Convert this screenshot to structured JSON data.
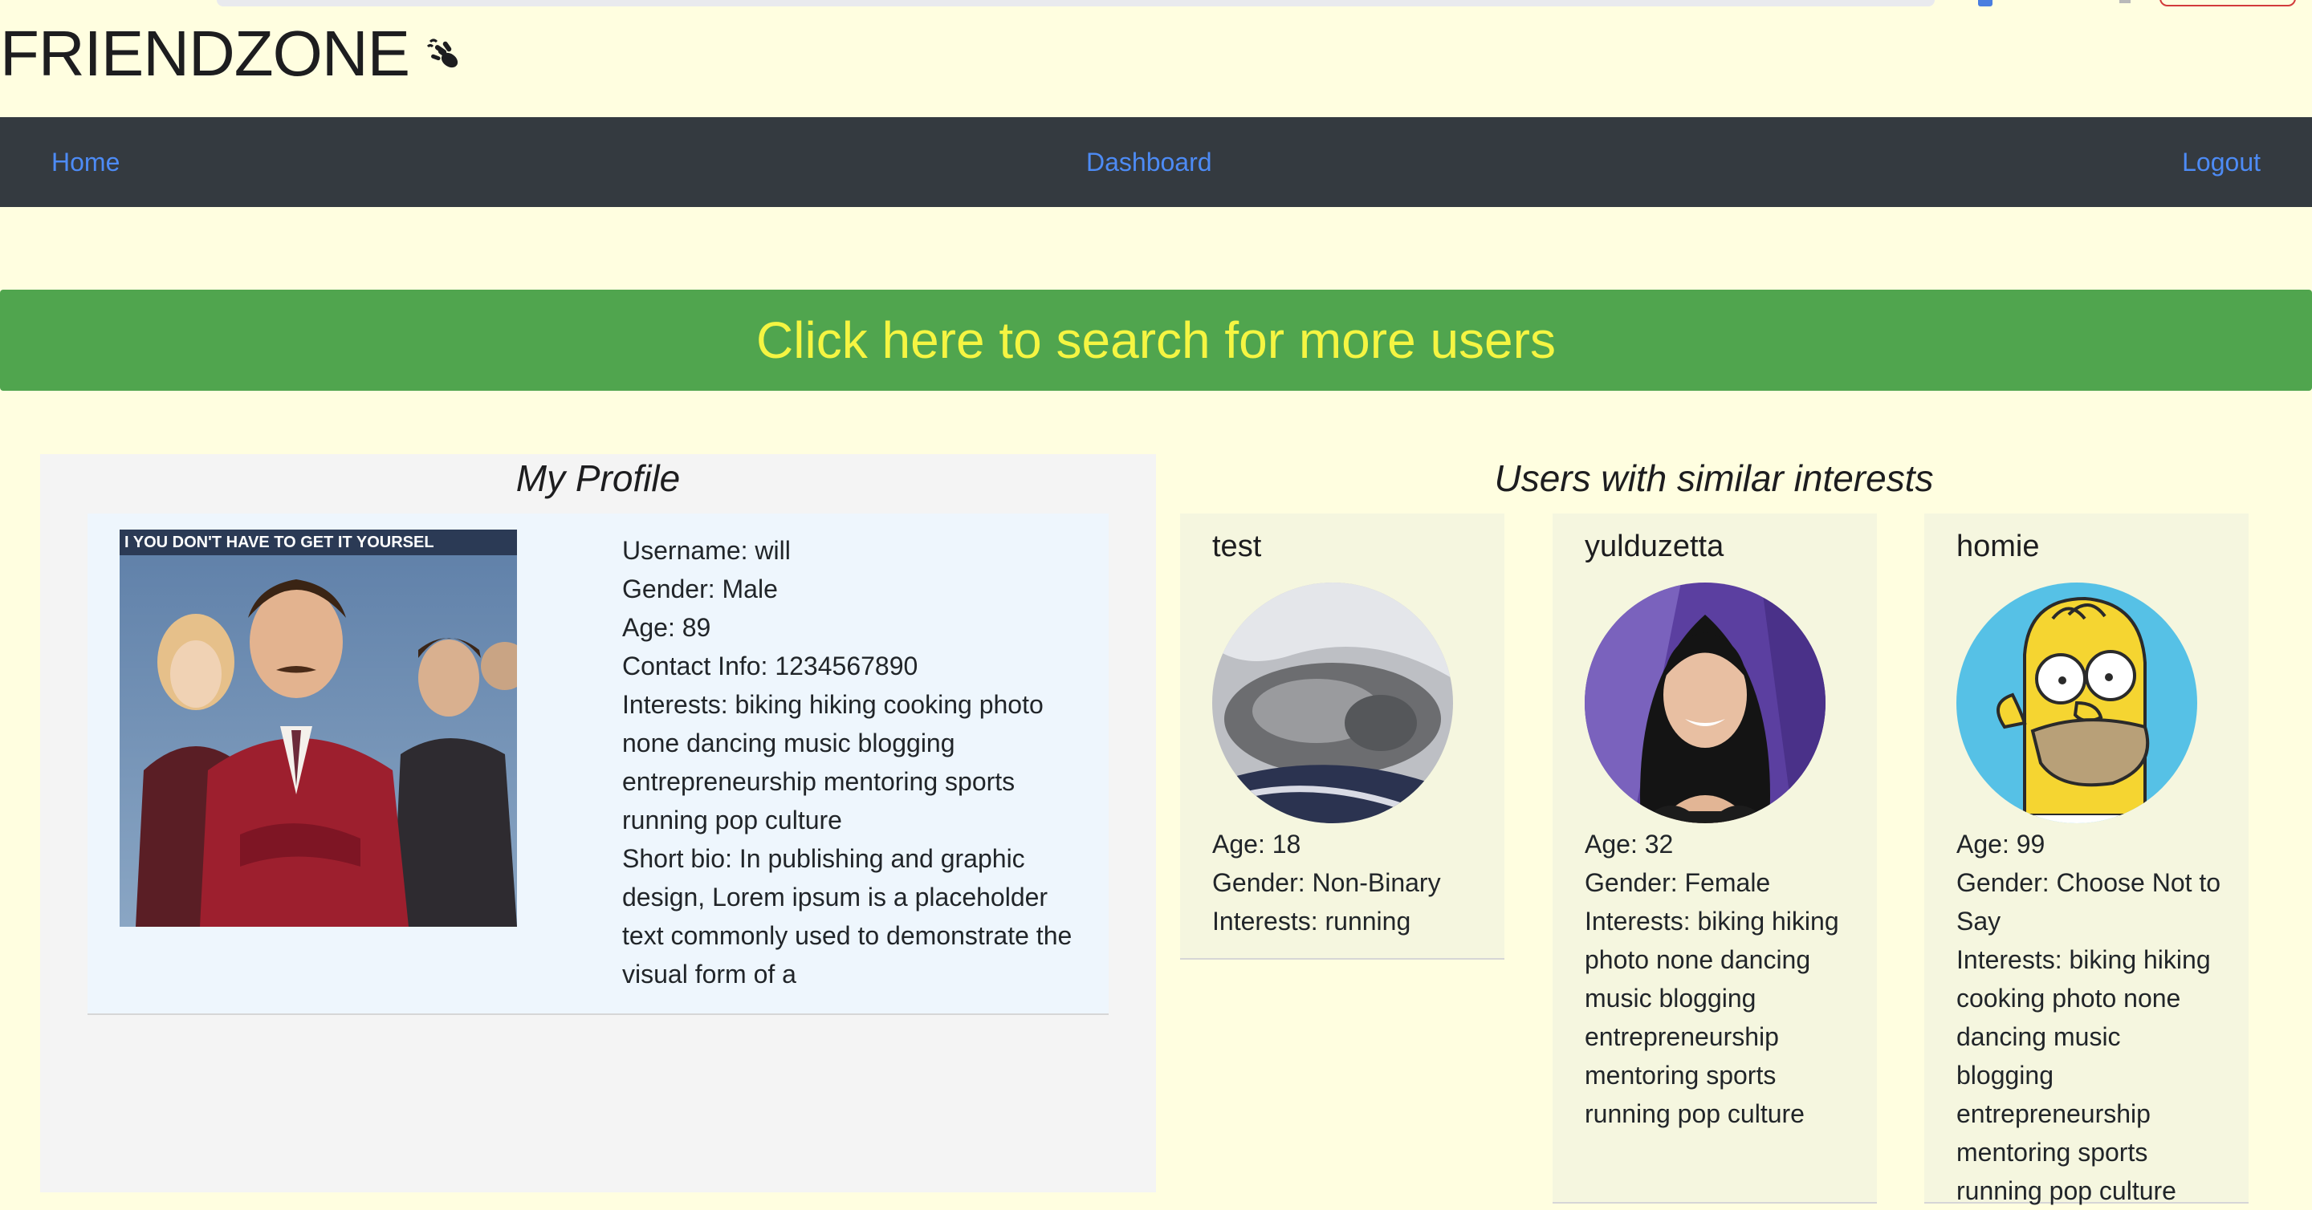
{
  "brand": {
    "title": "FRIENDZONE",
    "icon": "hand-wave-icon"
  },
  "nav": {
    "home": "Home",
    "dashboard": "Dashboard",
    "logout": "Logout"
  },
  "search_banner": {
    "label": "Click here to search for more users"
  },
  "my_profile": {
    "title": "My Profile",
    "photo_caption": "I YOU DON'T HAVE TO GET IT YOURSEL",
    "username": "Username: will",
    "gender": "Gender: Male",
    "age": "Age: 89",
    "contact": "Contact Info: 1234567890",
    "interests": "Interests: biking hiking cooking photo none dancing music blogging entrepreneurship mentoring sports running pop culture",
    "bio": "Short bio: In publishing and graphic design, Lorem ipsum is a placeholder text commonly used to demonstrate the visual form of a"
  },
  "similar": {
    "title": "Users with similar interests",
    "users": [
      {
        "name": "test",
        "age": "Age: 18",
        "gender": "Gender: Non-Binary",
        "interests": "Interests: running"
      },
      {
        "name": "yulduzetta",
        "age": "Age: 32",
        "gender": "Gender: Female",
        "interests": "Interests: biking hiking photo none dancing music blogging entrepreneurship mentoring sports running pop culture"
      },
      {
        "name": "homie",
        "age": "Age: 99",
        "gender": "Gender: Choose Not to Say",
        "interests": "Interests: biking hiking cooking photo none dancing music blogging entrepreneurship mentoring sports running pop culture"
      }
    ]
  },
  "colors": {
    "background": "#fffee0",
    "navbar": "#343a40",
    "link": "#4d8bf5",
    "banner": "#50a54e",
    "banner_text": "#f5f542"
  }
}
